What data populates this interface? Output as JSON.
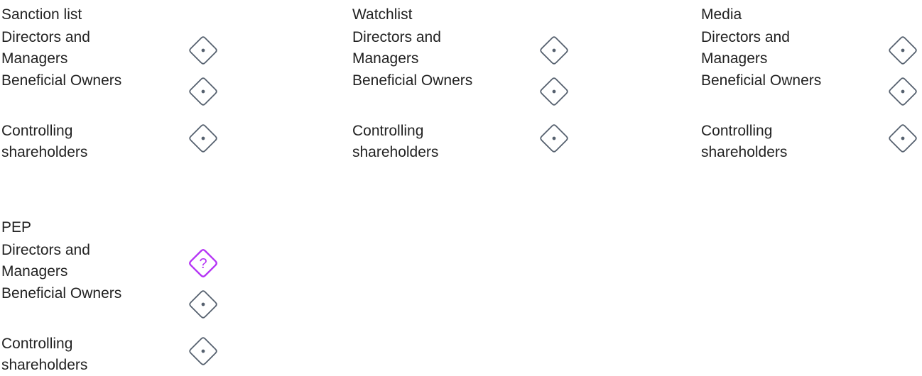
{
  "sections": [
    {
      "title": "Sanction list",
      "rows": [
        {
          "label": "Directors and Managers",
          "status_icon": "neutral-diamond-dot-icon"
        },
        {
          "label": "Beneficial Owners",
          "status_icon": "neutral-diamond-dot-icon"
        },
        {
          "label": "Controlling shareholders",
          "status_icon": "neutral-diamond-dot-icon"
        }
      ]
    },
    {
      "title": "Watchlist",
      "rows": [
        {
          "label": "Directors and Managers",
          "status_icon": "neutral-diamond-dot-icon"
        },
        {
          "label": "Beneficial Owners",
          "status_icon": "neutral-diamond-dot-icon"
        },
        {
          "label": "Controlling shareholders",
          "status_icon": "neutral-diamond-dot-icon"
        }
      ]
    },
    {
      "title": "Media",
      "rows": [
        {
          "label": "Directors and Managers",
          "status_icon": "neutral-diamond-dot-icon"
        },
        {
          "label": "Beneficial Owners",
          "status_icon": "neutral-diamond-dot-icon"
        },
        {
          "label": "Controlling shareholders",
          "status_icon": "neutral-diamond-dot-icon"
        }
      ]
    },
    {
      "title": "PEP",
      "rows": [
        {
          "label": "Directors and Managers",
          "status_icon": "question-diamond-icon"
        },
        {
          "label": "Beneficial Owners",
          "status_icon": "neutral-diamond-dot-icon"
        },
        {
          "label": "Controlling shareholders",
          "status_icon": "neutral-diamond-dot-icon"
        }
      ]
    }
  ],
  "colors": {
    "neutral_icon": "#55606e",
    "question_icon": "#b535f5",
    "text": "#222222"
  }
}
